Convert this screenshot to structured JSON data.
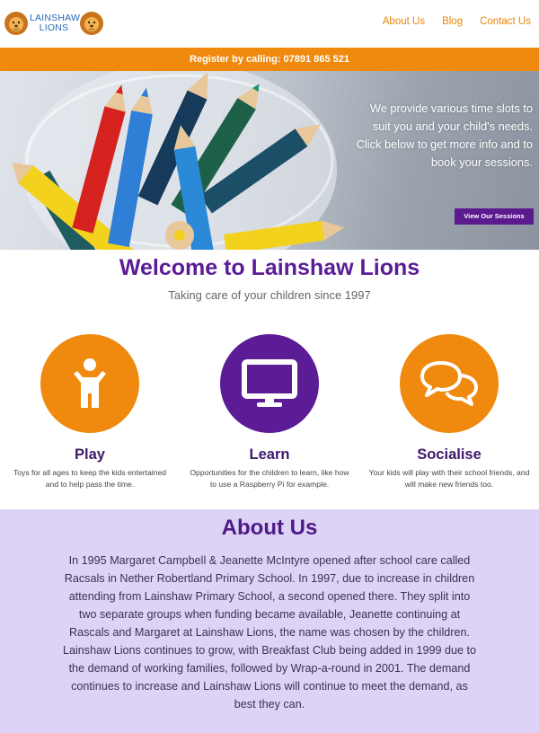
{
  "header": {
    "logo_text": "LAINSHAW LIONS",
    "nav": [
      "About Us",
      "Blog",
      "Contact Us"
    ]
  },
  "register_bar": {
    "text": "Register by calling: 07891 865 521"
  },
  "hero": {
    "text": "We provide various time slots to suit you and your child's needs. Click below to get more info and to book your sessions.",
    "button": "View Our Sessions"
  },
  "welcome": {
    "title": "Welcome to Lainshaw Lions",
    "subtitle": "Taking care of your children since 1997"
  },
  "features": [
    {
      "title": "Play",
      "desc": "Toys for all ages to keep the kids entertained and to help pass the time.",
      "icon": "child-icon",
      "color": "#f08a0f"
    },
    {
      "title": "Learn",
      "desc": "Opportunities for the children to learn, like how to use a Raspberry Pi for example.",
      "icon": "monitor-icon",
      "color": "#5b1c96"
    },
    {
      "title": "Socialise",
      "desc": "Your kids will play with their school friends, and will make new friends too.",
      "icon": "chat-bubbles-icon",
      "color": "#f08a0f"
    }
  ],
  "about": {
    "title": "About Us",
    "text": "In 1995 Margaret Campbell & Jeanette McIntyre opened after school care called Racsals in Nether Robertland Primary School. In 1997, due to increase in children attending from Lainshaw Primary School, a second opened there. They split into two separate groups when funding became available, Jeanette continuing at Rascals and Margaret at Lainshaw Lions, the name was chosen by the children. Lainshaw Lions continues to grow, with Breakfast Club being added in 1999 due to the demand of working families, followed by Wrap-a-round in 2001. The demand continues to increase and Lainshaw Lions will continue to meet the demand, as best they can."
  },
  "colors": {
    "orange": "#f08a0f",
    "purple": "#5b1c96",
    "lavender": "#dcd3f6",
    "logo_blue": "#2a6ab8"
  }
}
